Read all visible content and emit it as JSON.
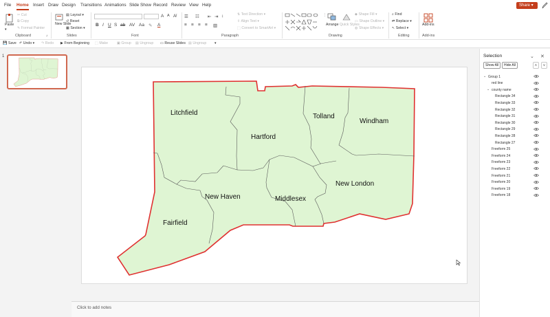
{
  "menu": {
    "tabs": [
      "File",
      "Home",
      "Insert",
      "Draw",
      "Design",
      "Transitions",
      "Animations",
      "Slide Show",
      "Record",
      "Review",
      "View",
      "Help"
    ],
    "active_tab": "Home",
    "share_label": "Share"
  },
  "ribbon": {
    "clipboard": {
      "paste": "Paste",
      "cut": "Cut",
      "copy": "Copy",
      "format_painter": "Format Painter",
      "label": "Clipboard"
    },
    "slides": {
      "new_slide": "New Slide",
      "layout": "Layout",
      "reset": "Reset",
      "section": "Section",
      "label": "Slides"
    },
    "font": {
      "label": "Font"
    },
    "paragraph": {
      "text_direction": "Text Direction",
      "align_text": "Align Text",
      "convert_smartart": "Convert to SmartArt",
      "label": "Paragraph"
    },
    "drawing": {
      "arrange": "Arrange",
      "quick_styles": "Quick Styles",
      "shape_fill": "Shape Fill",
      "shape_outline": "Shape Outline",
      "shape_effects": "Shape Effects",
      "label": "Drawing"
    },
    "editing": {
      "find": "Find",
      "replace": "Replace",
      "select": "Select",
      "label": "Editing"
    },
    "addins": {
      "addins": "Add-ins",
      "label": "Add-ins"
    }
  },
  "qat": {
    "save": "Save",
    "undo": "Undo",
    "redo": "Redo",
    "from_beginning": "From Beginning",
    "make_shape": "Make",
    "group": "Group",
    "ungroup": "Ungroup",
    "reuse_slides": "Reuse Slides",
    "ungroup2": "Ungroup"
  },
  "thumbnails": {
    "slide_number": "1"
  },
  "slide": {
    "counties": {
      "litchfield": "Litchfield",
      "hartford": "Hartford",
      "tolland": "Tolland",
      "windham": "Windham",
      "new_haven": "New Haven",
      "middlesex": "Middlesex",
      "new_london": "New London",
      "fairfield": "Fairfield"
    },
    "map_fill": "#dff5d3",
    "outline_color": "#e03030",
    "border_color": "#5a5a5a"
  },
  "notes": {
    "placeholder": "Click to add notes"
  },
  "selection_pane": {
    "title": "Selection",
    "show_all": "Show All",
    "hide_all": "Hide All",
    "items": [
      {
        "label": "Group 1",
        "level": 0,
        "expandable": true
      },
      {
        "label": "red line",
        "level": 1,
        "expandable": false
      },
      {
        "label": "county name",
        "level": 1,
        "expandable": true
      },
      {
        "label": "Rectangle 34",
        "level": 2,
        "expandable": false
      },
      {
        "label": "Rectangle 33",
        "level": 2,
        "expandable": false
      },
      {
        "label": "Rectangle 32",
        "level": 2,
        "expandable": false
      },
      {
        "label": "Rectangle 31",
        "level": 2,
        "expandable": false
      },
      {
        "label": "Rectangle 30",
        "level": 2,
        "expandable": false
      },
      {
        "label": "Rectangle 29",
        "level": 2,
        "expandable": false
      },
      {
        "label": "Rectangle 28",
        "level": 2,
        "expandable": false
      },
      {
        "label": "Rectangle 27",
        "level": 2,
        "expandable": false
      },
      {
        "label": "Freeform 25",
        "level": 1,
        "expandable": false
      },
      {
        "label": "Freeform 24",
        "level": 1,
        "expandable": false
      },
      {
        "label": "Freeform 23",
        "level": 1,
        "expandable": false
      },
      {
        "label": "Freeform 22",
        "level": 1,
        "expandable": false
      },
      {
        "label": "Freeform 21",
        "level": 1,
        "expandable": false
      },
      {
        "label": "Freeform 20",
        "level": 1,
        "expandable": false
      },
      {
        "label": "Freeform 19",
        "level": 1,
        "expandable": false
      },
      {
        "label": "Freeform 18",
        "level": 1,
        "expandable": false
      }
    ]
  }
}
